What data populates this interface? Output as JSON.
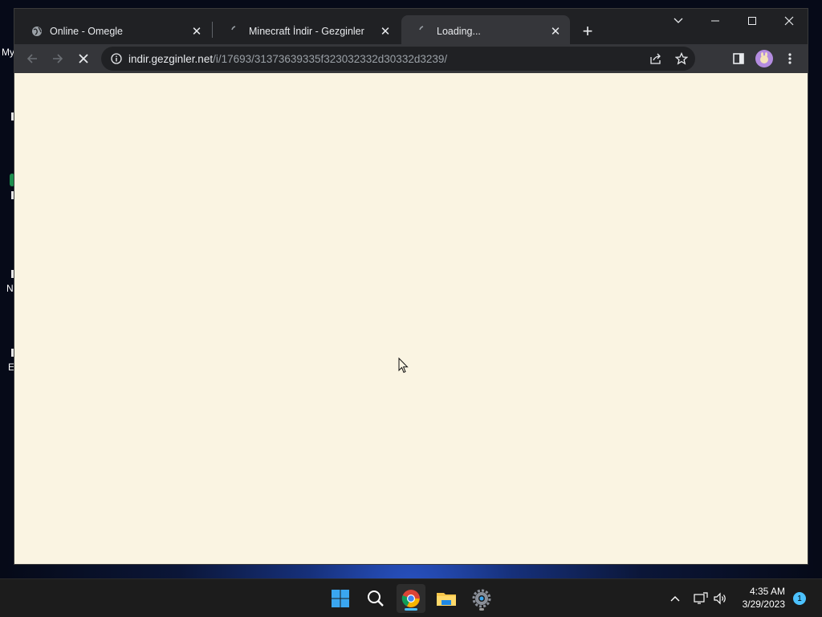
{
  "desktop": {
    "icon_fragments": [
      "My",
      "N",
      "E"
    ]
  },
  "browser": {
    "tabs": [
      {
        "title": "Online - Omegle",
        "favicon": "globe-icon",
        "active": false
      },
      {
        "title": "Minecraft İndir - Gezginler",
        "favicon": "loading-spinner-icon",
        "active": false
      },
      {
        "title": "Loading...",
        "favicon": "loading-spinner-icon",
        "active": true
      }
    ],
    "new_tab_symbol": "+",
    "address": {
      "host": "indir.gezginler.net",
      "path": "/i/17693/31373639335f323032332d30332d3239/"
    },
    "content_background": "#faf4e2"
  },
  "taskbar": {
    "apps": [
      "windows-start-icon",
      "search-icon",
      "chrome-icon",
      "file-explorer-icon",
      "settings-icon"
    ],
    "clock": {
      "time": "4:35 AM",
      "date": "3/29/2023"
    },
    "notification_count": "1"
  },
  "colors": {
    "accent": "#4cc2ff",
    "tab_active": "#35363a",
    "frame": "#202124"
  }
}
